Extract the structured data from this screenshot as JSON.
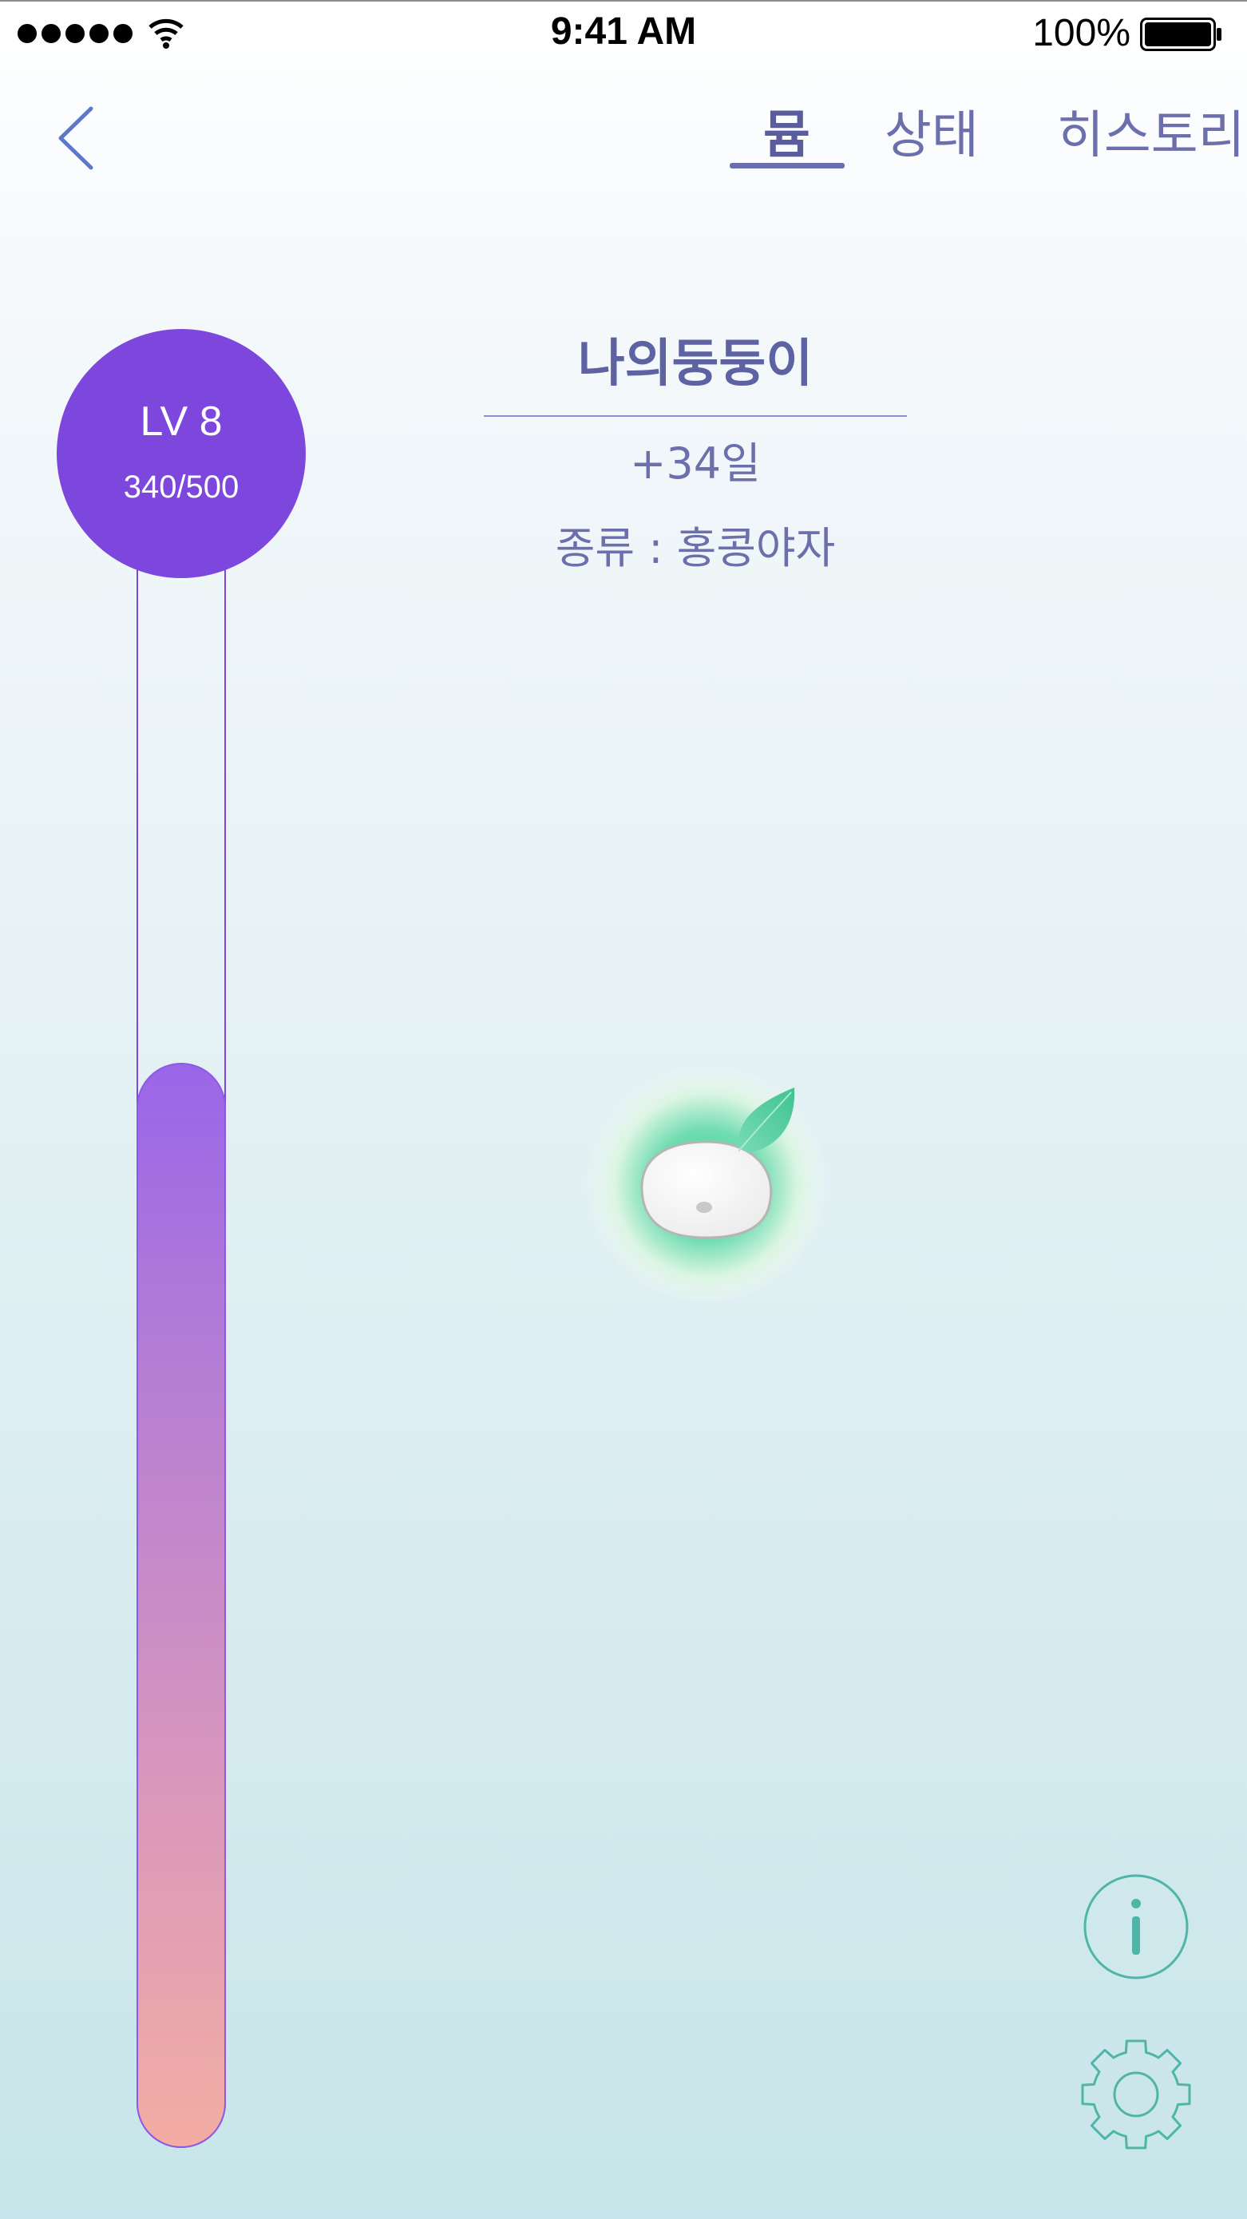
{
  "status_bar": {
    "time": "9:41 AM",
    "battery_percent": "100%",
    "icons": [
      "signal-dots-icon",
      "wifi-icon",
      "battery-icon"
    ]
  },
  "nav": {
    "back_icon": "chevron-left-icon",
    "tabs": [
      {
        "label": "뮴",
        "active": true
      },
      {
        "label": "상태",
        "active": false
      },
      {
        "label": "히스토리",
        "active": false
      }
    ]
  },
  "level": {
    "title": "LV 8",
    "xp": "340/500",
    "progress_fraction": 0.68
  },
  "pet": {
    "name": "나의둥둥이",
    "days": "+34일",
    "species": "종류 : 홍콩야자"
  },
  "actions": {
    "info_icon": "info-icon",
    "settings_icon": "gear-icon"
  },
  "colors": {
    "accent": "#7d47dd",
    "text": "#6b6fab",
    "icon_teal": "#4fb5a8",
    "leaf": "#5ccfa3"
  }
}
